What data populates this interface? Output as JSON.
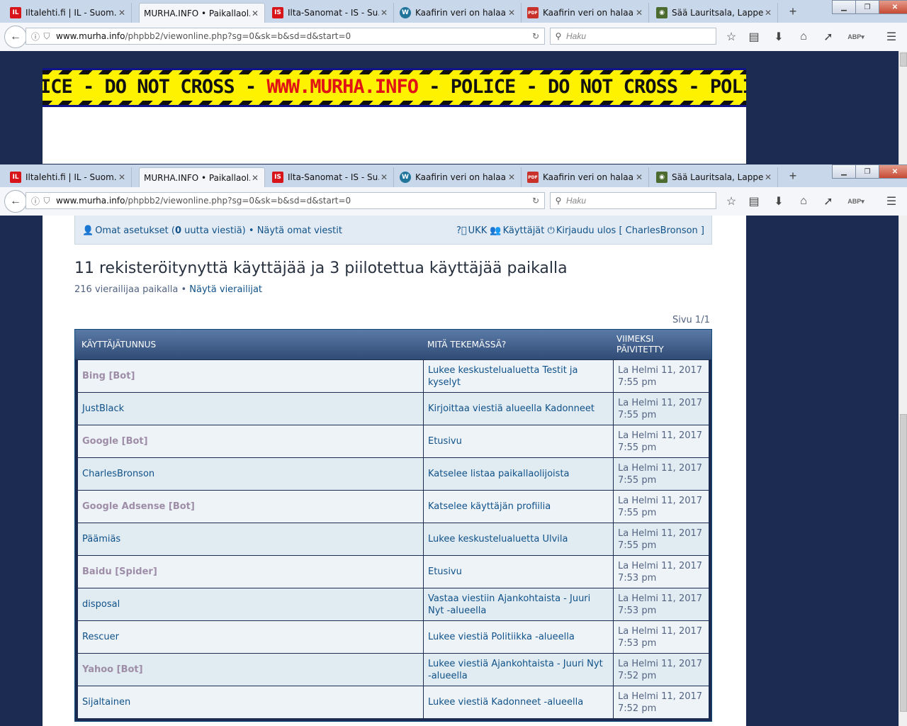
{
  "tabs": [
    {
      "label": "Iltalehti.fi | IL - Suom...",
      "icon": "iltalehti-icon",
      "active": false
    },
    {
      "label": "MURHA.INFO • Paikallaol...",
      "icon": "none",
      "active": true
    },
    {
      "label": "Ilta-Sanomat - IS - Su...",
      "icon": "iltasanomat-icon",
      "active": false
    },
    {
      "label": "Kaafirin veri on halaal...",
      "icon": "wordpress-icon",
      "active": false
    },
    {
      "label": "Kaafirin veri on halaal...",
      "icon": "pdf-icon",
      "active": false
    },
    {
      "label": "Sää Lauritsala, Lappe...",
      "icon": "globe-icon",
      "active": false
    }
  ],
  "url": {
    "host": "www.murha.info",
    "path": "/phpbb2/viewonline.php?sg=0&sk=b&sd=d&start=0"
  },
  "search": {
    "placeholder": "Haku"
  },
  "banner": {
    "pre": "ICE - DO NOT CROSS - ",
    "site": "WWW.MURHA.INFO",
    "post": " - POLICE - DO NOT CROSS - POLICE - DO NOT CROSS - POLICE"
  },
  "userbar": {
    "settings_prefix": "Omat asetukset (",
    "new_count": "0",
    "settings_suffix": " uutta viestiä)",
    "sep": " • ",
    "own_posts": "Näytä omat viestit",
    "faq": "UKK",
    "members": "Käyttäjät",
    "logout": "Kirjaudu ulos [ CharlesBronson ]"
  },
  "page": {
    "title": "11 rekisteröitynyttä käyttäjää ja 3 piilotettua käyttäjää paikalla",
    "guests": "216 vierailijaa paikalla",
    "show_guests": "Näytä vierailijat",
    "pageinfo": "Sivu 1/1"
  },
  "table": {
    "headers": [
      "KÄYTTÄJÄTUNNUS",
      "MITÄ TEKEMÄSSÄ?",
      "VIIMEKSI PÄIVITETTY"
    ],
    "rows": [
      {
        "user": "Bing [Bot]",
        "bot": true,
        "activity": "Lukee keskustelualuetta Testit ja kyselyt",
        "updated": "La Helmi 11, 2017 7:55 pm"
      },
      {
        "user": "JustBlack",
        "bot": false,
        "activity": "Kirjoittaa viestiä alueella Kadonneet",
        "updated": "La Helmi 11, 2017 7:55 pm"
      },
      {
        "user": "Google [Bot]",
        "bot": true,
        "activity": "Etusivu",
        "updated": "La Helmi 11, 2017 7:55 pm"
      },
      {
        "user": "CharlesBronson",
        "bot": false,
        "activity": "Katselee listaa paikallaolijoista",
        "updated": "La Helmi 11, 2017 7:55 pm"
      },
      {
        "user": "Google Adsense [Bot]",
        "bot": true,
        "activity": "Katselee käyttäjän profiilia",
        "updated": "La Helmi 11, 2017 7:55 pm"
      },
      {
        "user": "Päämiäs",
        "bot": false,
        "activity": "Lukee keskustelualuetta Ulvila",
        "updated": "La Helmi 11, 2017 7:55 pm"
      },
      {
        "user": "Baidu [Spider]",
        "bot": true,
        "activity": "Etusivu",
        "updated": "La Helmi 11, 2017 7:53 pm"
      },
      {
        "user": "disposal",
        "bot": false,
        "activity": "Vastaa viestiin Ajankohtaista - Juuri Nyt -alueella",
        "updated": "La Helmi 11, 2017 7:53 pm"
      },
      {
        "user": "Rescuer",
        "bot": false,
        "activity": "Lukee viestiä Politiikka -alueella",
        "updated": "La Helmi 11, 2017 7:53 pm"
      },
      {
        "user": "Yahoo [Bot]",
        "bot": true,
        "activity": "Lukee viestiä Ajankohtaista - Juuri Nyt -alueella",
        "updated": "La Helmi 11, 2017 7:52 pm"
      },
      {
        "user": "Sijaltainen",
        "bot": false,
        "activity": "Lukee viestiä Kadonneet -alueella",
        "updated": "La Helmi 11, 2017 7:52 pm"
      }
    ]
  },
  "colors": {
    "bot_name": "#9e8da7",
    "link": "#105289",
    "page_bg": "#1c2b52",
    "tape_yellow": "#fff200",
    "tape_red": "#e01414"
  }
}
